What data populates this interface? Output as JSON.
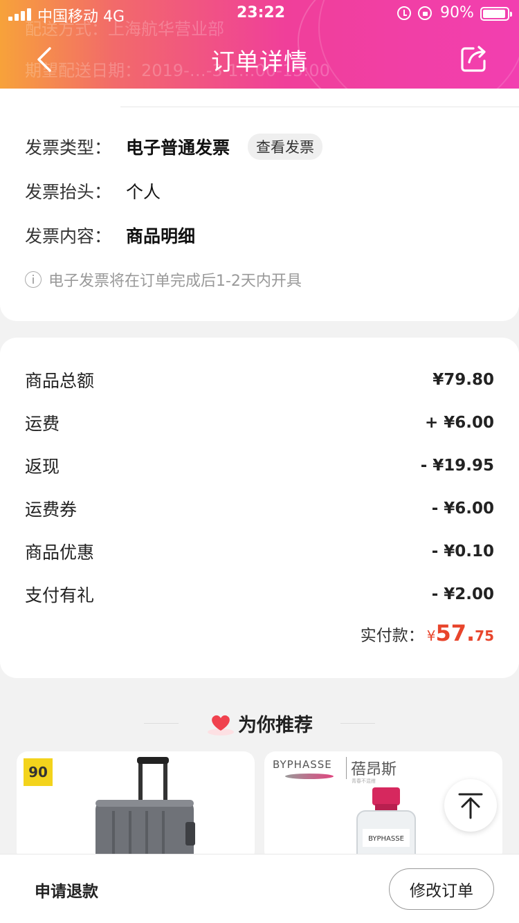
{
  "status_bar": {
    "carrier": "中国移动 4G",
    "time": "23:22",
    "battery": "90%"
  },
  "header": {
    "title": "订单详情",
    "ghost_line1": "配送方式：上海航华营业部",
    "ghost_line2": "期望配送日期：2019-…-3 1…00-15:00"
  },
  "invoice": {
    "type_label": "发票类型：",
    "type_value": "电子普通发票",
    "view_button": "查看发票",
    "title_label": "发票抬头：",
    "title_value": "个人",
    "content_label": "发票内容：",
    "content_value": "商品明细",
    "note": "电子发票将在订单完成后1-2天内开具"
  },
  "summary": {
    "rows": [
      {
        "label": "商品总额",
        "value": "¥79.80"
      },
      {
        "label": "运费",
        "value": "+ ¥6.00"
      },
      {
        "label": "返现",
        "value": "- ¥19.95"
      },
      {
        "label": "运费券",
        "value": "- ¥6.00"
      },
      {
        "label": "商品优惠",
        "value": "- ¥0.10"
      },
      {
        "label": "支付有礼",
        "value": "- ¥2.00"
      }
    ],
    "paid_label": "实付款：",
    "paid_currency": "¥",
    "paid_integer": "57.",
    "paid_decimal": "75"
  },
  "recommend": {
    "title": "为你推荐",
    "products": [
      {
        "badge": "90"
      },
      {
        "brand_en": "BYPHASSE",
        "brand_cn": "蓓昂斯",
        "brand_sub": "青春不混搭",
        "bottle_label": "BYPHASSE"
      }
    ]
  },
  "bottom_bar": {
    "refund": "申请退款",
    "modify": "修改订单"
  },
  "colors": {
    "accent_price": "#e8452c",
    "header_start": "#f7a23a",
    "header_end": "#f23fb0"
  }
}
